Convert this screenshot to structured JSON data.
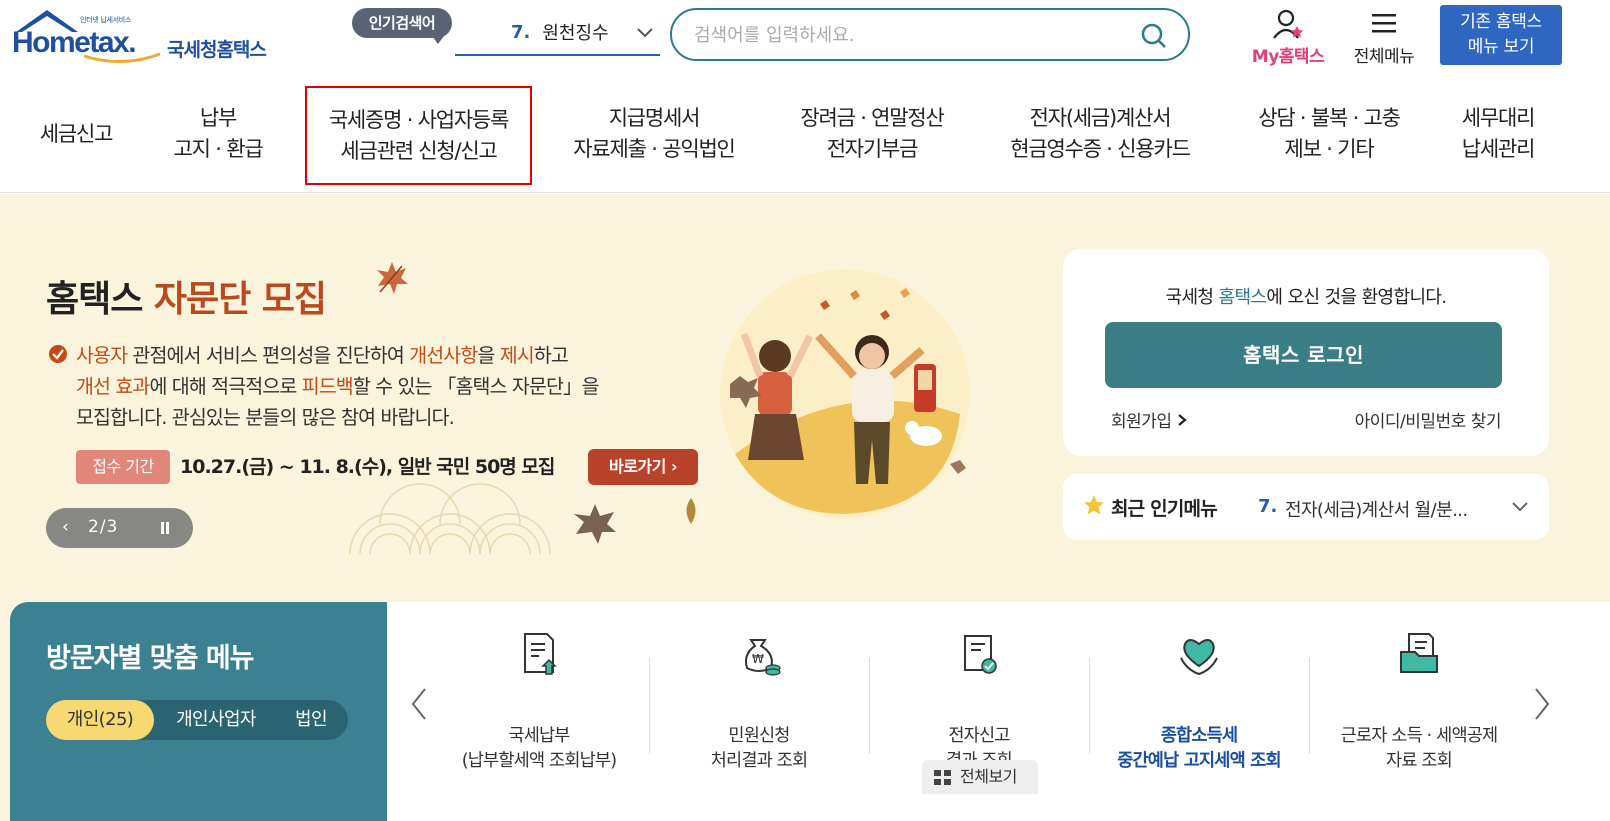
{
  "header": {
    "logo_small": "인터넷 납세서비스",
    "logo_home": "Home",
    "logo_tax": "tax.",
    "logo_kr": "국세청홈택스",
    "popular_badge": "인기검색어",
    "popular_num": "7.",
    "popular_value": "원천징수",
    "search_placeholder": "검색어를 입력하세요.",
    "my_hometax": "My홈택스",
    "all_menu": "전체메뉴",
    "old_menu_line1": "기존 홈택스",
    "old_menu_line2": "메뉴 보기"
  },
  "gnb": [
    {
      "l1": "세금신고",
      "l2": ""
    },
    {
      "l1": "납부",
      "l2": "고지 · 환급"
    },
    {
      "l1": "국세증명 · 사업자등록",
      "l2": "세금관련 신청/신고"
    },
    {
      "l1": "지급명세서",
      "l2": "자료제출 · 공익법인"
    },
    {
      "l1": "장려금 · 연말정산",
      "l2": "전자기부금"
    },
    {
      "l1": "전자(세금)계산서",
      "l2": "현금영수증 · 신용카드"
    },
    {
      "l1": "상담 · 불복 · 고충",
      "l2": "제보 · 기타"
    },
    {
      "l1": "세무대리",
      "l2": "납세관리"
    }
  ],
  "banner": {
    "title_a": "홈택스 ",
    "title_b": "자문단 모집",
    "line1_a": "사용자",
    "line1_b": " 관점에서 서비스 편의성을 진단하여 ",
    "line1_c": "개선사항",
    "line1_d": "을 ",
    "line1_e": "제시",
    "line1_f": "하고",
    "line2_a": "개선 효과",
    "line2_b": "에 대해 적극적으로 ",
    "line2_c": "피드백",
    "line2_d": "할 수 있는 「홈택스 자문단」을",
    "line3": "모집합니다. 관심있는 분들의 많은 참여 바랍니다.",
    "period_label": "접수 기간",
    "period_text": "10.27.(금) ~ 11. 8.(수), 일반 국민 50명 모집",
    "go_button": "바로가기",
    "pager": "2/3"
  },
  "login": {
    "welcome_a": "국세청 ",
    "welcome_b": "홈택스",
    "welcome_c": "에 오신 것을 환영합니다.",
    "login_button": "홈택스 로그인",
    "join": "회원가입",
    "find": "아이디/비밀번호 찾기"
  },
  "recent": {
    "title": "최근 인기메뉴",
    "num": "7.",
    "value": "전자(세금)계산서 월/분..."
  },
  "visitor": {
    "title": "방문자별 맞춤 메뉴",
    "tabs": [
      "개인(25)",
      "개인사업자",
      "법인"
    ]
  },
  "quick": {
    "items": [
      {
        "l1": "국세납부",
        "l2": "(납부할세액 조회납부)"
      },
      {
        "l1": "민원신청",
        "l2": "처리결과 조회"
      },
      {
        "l1": "전자신고",
        "l2": "결과 조회"
      },
      {
        "l1": "종합소득세",
        "l2": "중간예납 고지세액 조회"
      },
      {
        "l1": "근로자 소득 · 세액공제",
        "l2": "자료 조회"
      }
    ],
    "view_all": "전체보기"
  },
  "colors": {
    "primary": "#1f4fa0",
    "teal": "#3a7d86",
    "banner_bg": "#fbf4dd",
    "accent_orange": "#c54a1a",
    "highlight_red": "#e30000"
  }
}
